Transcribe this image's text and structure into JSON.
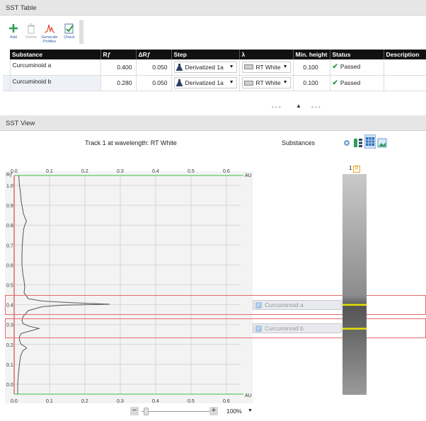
{
  "sst_table": {
    "header": "SST Table",
    "toolbar": [
      {
        "label": "Add",
        "icon": "plus-icon",
        "enabled": true
      },
      {
        "label": "Delete",
        "icon": "trash-icon",
        "enabled": false
      },
      {
        "label": "Generate Profiles",
        "icon": "profile-chart-icon",
        "enabled": true
      },
      {
        "label": "Check",
        "icon": "check-clipboard-icon",
        "enabled": true
      }
    ],
    "columns": [
      "Substance",
      "Rƒ",
      "ΔRƒ",
      "Step",
      "λ",
      "Min. height",
      "Status",
      "Description"
    ],
    "rows": [
      {
        "substance": "Curcuminoid a",
        "rf": "0.400",
        "drf": "0.050",
        "step": "Derivatized 1a",
        "lambda": "RT White",
        "min_height": "0.100",
        "status": "Passed",
        "description": ""
      },
      {
        "substance": "Curcuminoid b",
        "rf": "0.280",
        "drf": "0.050",
        "step": "Derivatized 1a",
        "lambda": "RT White",
        "min_height": "0.100",
        "status": "Passed",
        "description": ""
      }
    ]
  },
  "sst_view": {
    "header": "SST View",
    "chart_title": "Track 1 at wavelength: RT White",
    "substances_title": "Substances",
    "track_number": "1",
    "track_badge": "R",
    "substances": [
      {
        "name": "Curcuminoid a",
        "checked": true
      },
      {
        "name": "Curcuminoid b",
        "checked": true
      }
    ],
    "zoom": {
      "minus": "−",
      "plus": "+",
      "percent": "100%",
      "level": 0.03
    }
  },
  "colors": {
    "axis_green": "#3cc23c",
    "band_red": "#e56b6b",
    "marker_yellow": "#e8e000",
    "passed_green": "#2e9b47",
    "header_black": "#111111"
  },
  "chart_data": {
    "type": "line",
    "x_axis_label": "AU",
    "y_axis_label": "Rƒ",
    "x_ticks": [
      "0.0",
      "0.1",
      "0.2",
      "0.3",
      "0.4",
      "0.5",
      "0.6"
    ],
    "y_ticks": [
      "0.0",
      "0.1",
      "0.2",
      "0.3",
      "0.4",
      "0.5",
      "0.6",
      "0.7",
      "0.8",
      "0.9",
      "1.0"
    ],
    "xlim": [
      0,
      0.65
    ],
    "ylim": [
      -0.05,
      1.05
    ],
    "grid": true,
    "series": [
      {
        "values": [
          [
            0.01,
            -0.05
          ],
          [
            0.01,
            0.0
          ],
          [
            0.012,
            0.05
          ],
          [
            0.015,
            0.1
          ],
          [
            0.018,
            0.14
          ],
          [
            0.025,
            0.17
          ],
          [
            0.035,
            0.18
          ],
          [
            0.03,
            0.19
          ],
          [
            0.02,
            0.2
          ],
          [
            0.015,
            0.22
          ],
          [
            0.015,
            0.24
          ],
          [
            0.02,
            0.255
          ],
          [
            0.04,
            0.265
          ],
          [
            0.07,
            0.28
          ],
          [
            0.04,
            0.293
          ],
          [
            0.025,
            0.305
          ],
          [
            0.022,
            0.32
          ],
          [
            0.025,
            0.34
          ],
          [
            0.04,
            0.37
          ],
          [
            0.08,
            0.39
          ],
          [
            0.14,
            0.398
          ],
          [
            0.27,
            0.402
          ],
          [
            0.16,
            0.41
          ],
          [
            0.08,
            0.418
          ],
          [
            0.04,
            0.43
          ],
          [
            0.028,
            0.46
          ],
          [
            0.03,
            0.49
          ],
          [
            0.028,
            0.52
          ],
          [
            0.025,
            0.55
          ],
          [
            0.022,
            0.6
          ],
          [
            0.022,
            0.65
          ],
          [
            0.023,
            0.7
          ],
          [
            0.025,
            0.75
          ],
          [
            0.027,
            0.78
          ],
          [
            0.03,
            0.8
          ],
          [
            0.035,
            0.82
          ],
          [
            0.03,
            0.84
          ],
          [
            0.026,
            0.86
          ],
          [
            0.024,
            0.88
          ],
          [
            0.02,
            0.92
          ],
          [
            0.018,
            0.96
          ],
          [
            0.015,
            1.0
          ],
          [
            0.013,
            1.05
          ]
        ]
      }
    ]
  },
  "bands": [
    {
      "substance": "Curcuminoid a",
      "rf": 0.4,
      "drf": 0.05
    },
    {
      "substance": "Curcuminoid b",
      "rf": 0.28,
      "drf": 0.05
    }
  ]
}
